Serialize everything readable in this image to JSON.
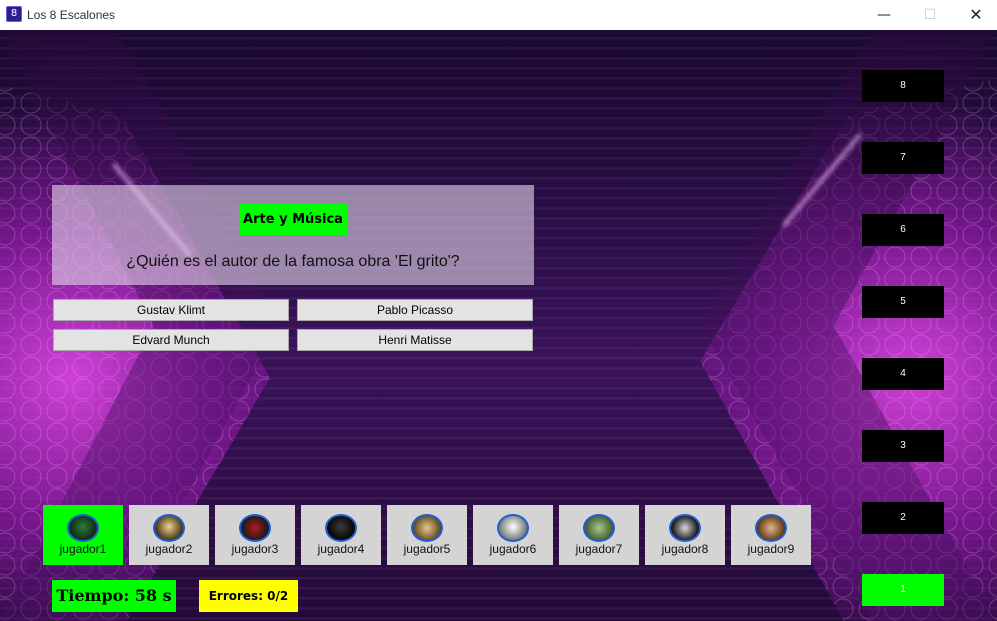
{
  "window": {
    "title": "Los 8 Escalones",
    "minimize": "—",
    "maximize": "☐",
    "close": "✕"
  },
  "question": {
    "category": "Arte y Música",
    "text": "¿Quién es el autor de la famosa obra 'El grito'?",
    "answers": [
      "Gustav Klimt",
      "Pablo Picasso",
      "Edvard Munch",
      "Henri Matisse"
    ]
  },
  "ladder": {
    "steps": [
      "8",
      "7",
      "6",
      "5",
      "4",
      "3",
      "2",
      "1"
    ],
    "current": "1"
  },
  "players": [
    {
      "name": "jugador1",
      "active": true
    },
    {
      "name": "jugador2",
      "active": false
    },
    {
      "name": "jugador3",
      "active": false
    },
    {
      "name": "jugador4",
      "active": false
    },
    {
      "name": "jugador5",
      "active": false
    },
    {
      "name": "jugador6",
      "active": false
    },
    {
      "name": "jugador7",
      "active": false
    },
    {
      "name": "jugador8",
      "active": false
    },
    {
      "name": "jugador9",
      "active": false
    }
  ],
  "status": {
    "timer": "Tiempo: 58 s",
    "errors": "Errores: 0/2"
  },
  "colors": {
    "highlight": "#00ff00",
    "errors_bg": "#ffff00",
    "step_bg": "#000000"
  }
}
